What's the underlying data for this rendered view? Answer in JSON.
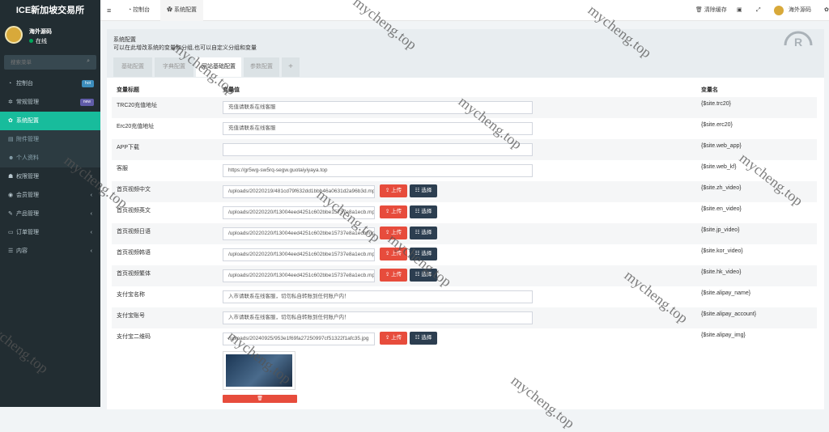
{
  "app": {
    "title": "ICE新加坡交易所",
    "user": "海外源码",
    "status": "在线",
    "search_placeholder": "搜索菜单"
  },
  "menu": [
    {
      "label": "控制台",
      "icon": "dashboard-icon",
      "badge": "hot",
      "badge_color": "#3c8dbc"
    },
    {
      "label": "常规管理",
      "icon": "cogs-icon",
      "badge": "new",
      "badge_color": "#605ca8"
    },
    {
      "label": "系统配置",
      "icon": "gear-icon"
    },
    {
      "label": "附件管理",
      "icon": "file-icon"
    },
    {
      "label": "个人资料",
      "icon": "user-icon"
    },
    {
      "label": "权限管理",
      "icon": "group-icon"
    },
    {
      "label": "会员管理",
      "icon": "user-circle-icon"
    },
    {
      "label": "产品管理",
      "icon": "edit-icon"
    },
    {
      "label": "订单管理",
      "icon": "cart-icon"
    },
    {
      "label": "内容",
      "icon": "list-icon"
    }
  ],
  "topbar": {
    "menu_icon": "≡",
    "tab1": "控制台",
    "tab2": "系统配置",
    "clear_cache": "清除缓存",
    "user": "海外源码"
  },
  "page": {
    "title": "系统配置",
    "desc": "可以在此增改系统的变量和分组,也可以自定义分组和变量"
  },
  "tabs": [
    "基础配置",
    "字典配置",
    "网站基础配置",
    "参数配置",
    "+"
  ],
  "table": {
    "col1": "变量标题",
    "col2": "变量值",
    "col3": "变量名",
    "upload_label": "上传",
    "select_label": "选择",
    "delete_label": "🗑"
  },
  "rows": [
    {
      "label": "TRC20充值地址",
      "value": "充值请联系在线客服",
      "var": "{$site.trc20}"
    },
    {
      "label": "Erc20充值地址",
      "value": "充值请联系在线客服",
      "var": "{$site.erc20}"
    },
    {
      "label": "APP下载",
      "value": "",
      "var": "{$site.web_app}"
    },
    {
      "label": "客服",
      "value": "https://gr5wg-sw5rq-segw.guotaiyiyaya.top",
      "var": "{$site.web_kf}"
    },
    {
      "label": "首页视频中文",
      "value": "/uploads/20220219/481cd79f632dd1bbb46a0631d2a96b3d.mp4",
      "var": "{$site.zh_video}",
      "file": true
    },
    {
      "label": "首页视频英文",
      "value": "/uploads/20220220/f13004eed4251c602bbe15737e8a1ecb.mp4",
      "var": "{$site.en_video}",
      "file": true
    },
    {
      "label": "首页视频日语",
      "value": "/uploads/20220220/f13004eed4251c602bbe15737e8a1ecb.mp4",
      "var": "{$site.jp_video}",
      "file": true
    },
    {
      "label": "首页视频韩语",
      "value": "/uploads/20220220/f13004eed4251c602bbe15737e8a1ecb.mp4",
      "var": "{$site.kor_video}",
      "file": true
    },
    {
      "label": "首页视频繁体",
      "value": "/uploads/20220220/f13004eed4251c602bbe15737e8a1ecb.mp4",
      "var": "{$site.hk_video}",
      "file": true
    },
    {
      "label": "支付宝名称",
      "value": "入市请联系在线客服，切勿私自转账到任何账户内！",
      "var": "{$site.alipay_name}"
    },
    {
      "label": "支付宝账号",
      "value": "入市请联系在线客服，切勿私自转账到任何账户内！",
      "var": "{$site.alipay_account}"
    },
    {
      "label": "支付宝二维码",
      "value": "/uploads/20240925/953e1f69fa27250997cf51322f1afc35.jpg",
      "var": "{$site.alipay_img}",
      "file": true
    }
  ],
  "watermark": "mycheng.top"
}
